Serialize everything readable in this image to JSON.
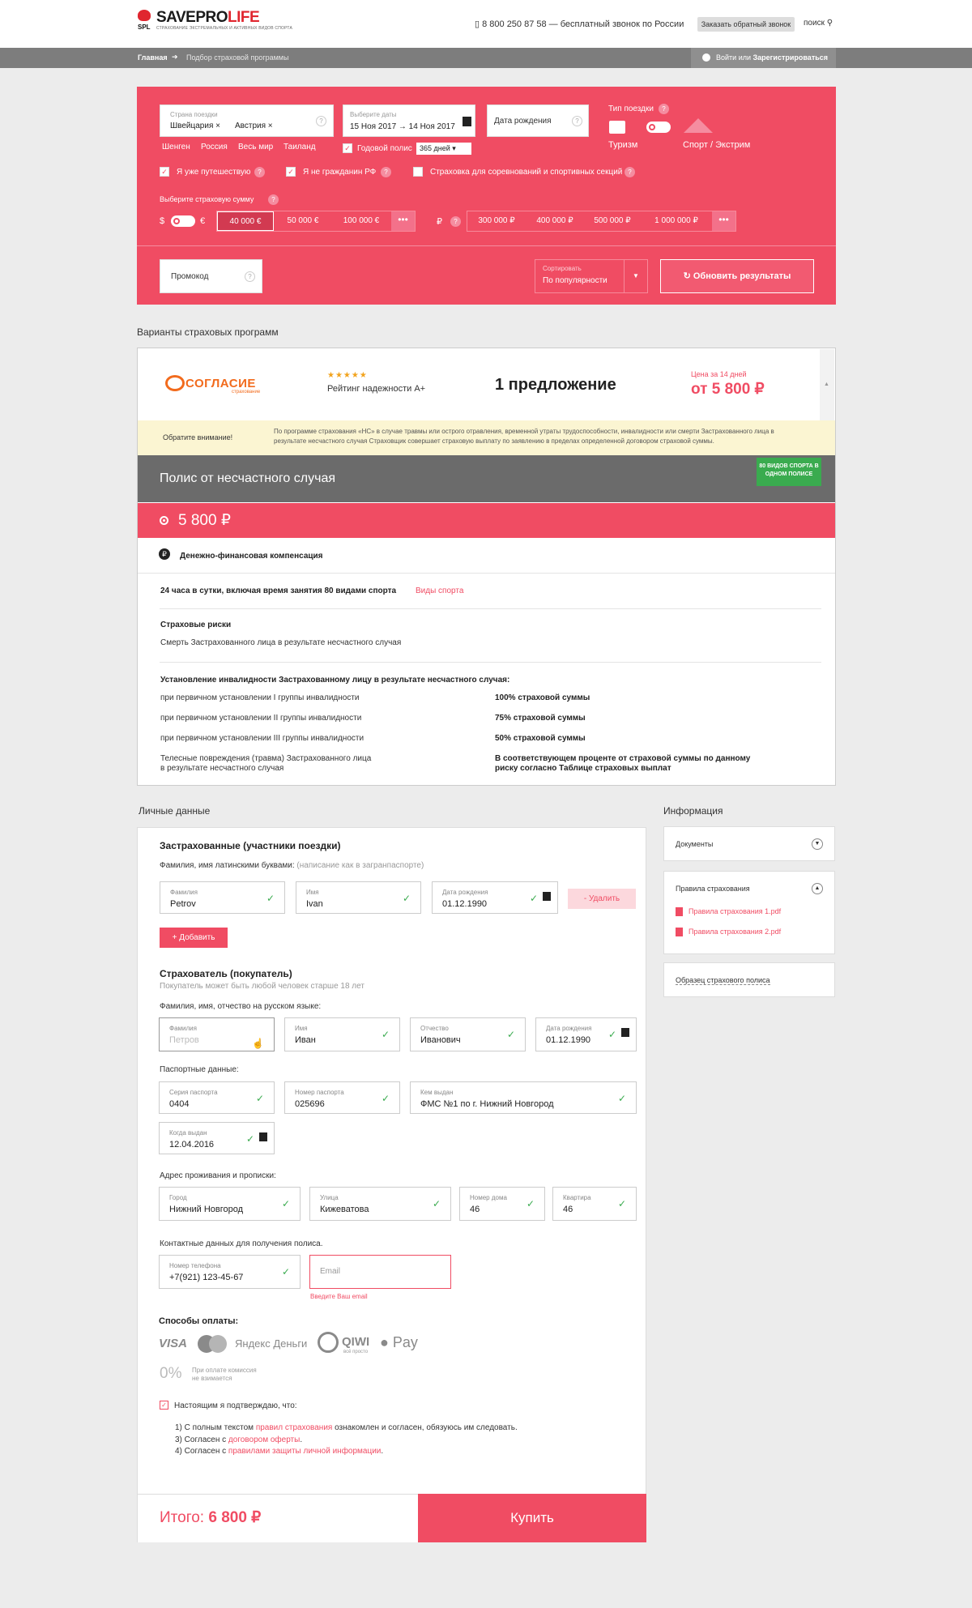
{
  "header": {
    "brand_a": "SAVEPRO",
    "brand_b": "LIFE",
    "brand_short": "SPL",
    "tagline": "СТРАХОВАНИЕ ЭКСТРЕМАЛЬНЫХ И АКТИВНЫХ ВИДОВ СПОРТА",
    "phone": "8 800 250 87 58 — бесплатный звонок по России",
    "callback": "Заказать обратный звонок",
    "search": "поиск"
  },
  "breadcrumb": {
    "home": "Главная",
    "current": "Подбор страховой программы",
    "login": "Войти",
    "or": "или",
    "register": "Зарегистрироваться"
  },
  "search_form": {
    "country_label": "Страна поездки",
    "country_tags": [
      "Швейцария ×",
      "Австрия ×"
    ],
    "quick_links": [
      "Шенген",
      "Россия",
      "Весь мир",
      "Таиланд"
    ],
    "dates_label": "Выберите даты",
    "dates_value": "15 Ноя 2017 → 14 Ноя 2017",
    "birth_placeholder": "Дата рождения",
    "annual_label": "Годовой полис",
    "annual_value": "365 дней",
    "trip_type_label": "Тип поездки",
    "trip_tourism": "Туризм",
    "trip_sport": "Спорт / Экстрим",
    "checks": [
      "Я уже путешествую",
      "Я не гражданин РФ",
      "Страховка для соревнований и спортивных секций"
    ],
    "sum_label": "Выберите страховую сумму",
    "cur_dollar": "$",
    "cur_euro": "€",
    "cur_rub": "₽",
    "sums_eur": [
      "40 000 €",
      "50 000 €",
      "100 000 €"
    ],
    "sums_rub": [
      "300 000 ₽",
      "400 000 ₽",
      "500 000 ₽",
      "1 000 000 ₽"
    ],
    "more": "•••",
    "promo": "Промокод",
    "sort_label": "Сортировать",
    "sort_value": "По популярности",
    "update": "Обновить результаты"
  },
  "results": {
    "title": "Варианты страховых программ",
    "insurer": "СОГЛАСИЕ",
    "insurer_sub": "страхование",
    "stars": "★★★★★",
    "rating": "Рейтинг надежности А+",
    "offers": "1 предложение",
    "price_label": "Цена за 14 дней",
    "price": "от 5 800 ₽",
    "notice_label": "Обратите внимание!",
    "notice_text": "По программе страхования «НС» в случае травмы или острого отравления, временной утраты трудоспособности, инвалидности или смерти Застрахованного лица в результате несчастного случая Страховщик совершает страховую выплату по заявлению в пределах определенной договором страховой суммы.",
    "policy_title": "Полис от несчастного случая",
    "badge": "80 ВИДОВ СПОРТА В ОДНОМ ПОЛИСЕ",
    "policy_price": "5 800 ₽",
    "compensation": "Денежно-финансовая компенсация",
    "coverage": "24 часа в сутки, включая время занятия 80 видами спорта",
    "sports_link": "Виды спорта",
    "risks_title": "Страховые риски",
    "risk1": "Смерть Застрахованного лица в результате несчастного случая",
    "disability_title": "Установление инвалидности Застрахованному лицу в результате несчастного случая:",
    "rows": [
      {
        "l": "при первичном установлении I группы инвалидности",
        "r": "100% страховой суммы"
      },
      {
        "l": "при первичном установлении II группы инвалидности",
        "r": "75% страховой суммы"
      },
      {
        "l": "при первичном установлении III группы инвалидности",
        "r": "50% страховой суммы"
      }
    ],
    "injury_l1": "Телесные повреждения (травма) Застрахованного лица",
    "injury_l2": "в результате несчастного случая",
    "injury_r1": "В соответствующем проценте от страховой суммы по данному",
    "injury_r2": "риску согласно Таблице страховых выплат"
  },
  "personal": {
    "title": "Личные данные",
    "insured_title": "Застрахованные (участники поездки)",
    "insured_hint": "Фамилия, имя латинскими буквами:",
    "insured_hint2": "(написание как в загранпаспорте)",
    "surname_l": "Фамилия",
    "surname_v": "Petrov",
    "name_l": "Имя",
    "name_v": "Ivan",
    "birth_l": "Дата рождения",
    "birth_v": "01.12.1990",
    "delete": "- Удалить",
    "add": "+ Добавить",
    "buyer_title": "Страхователь (покупатель)",
    "buyer_hint": "Покупатель может быть любой человек старше 18 лет",
    "fio_hint": "Фамилия, имя, отчество на русском языке:",
    "b_surname_l": "Фамилия",
    "b_surname_ph": "Петров",
    "b_name_l": "Имя",
    "b_name_v": "Иван",
    "b_patr_l": "Отчество",
    "b_patr_v": "Иванович",
    "b_birth_l": "Дата рождения",
    "b_birth_v": "01.12.1990",
    "passport_hint": "Паспортные данные:",
    "series_l": "Серия паспорта",
    "series_v": "0404",
    "number_l": "Номер паспорта",
    "number_v": "025696",
    "issued_l": "Кем выдан",
    "issued_v": "ФМС №1 по г. Нижний Новгород",
    "when_l": "Когда выдан",
    "when_v": "12.04.2016",
    "address_hint": "Адрес проживания и прописки:",
    "city_l": "Город",
    "city_v": "Нижний Новгород",
    "street_l": "Улица",
    "street_v": "Кижеватова",
    "house_l": "Номер дома",
    "house_v": "46",
    "flat_l": "Квартира",
    "flat_v": "46",
    "contact_hint": "Контактные данных для получения полиса.",
    "phone_l": "Номер телефона",
    "phone_v": "+7(921) 123-45-67",
    "email_ph": "Email",
    "email_err": "Введите Ваш email",
    "pay_title": "Способы оплаты:",
    "pay": [
      "VISA",
      "Яндекс Деньги",
      "QIWI",
      "Pay"
    ],
    "qiwi_sub": "всё просто",
    "commission": "0%",
    "commission_text": "При оплате комиссия не взимается",
    "confirm": "Настоящим я подтверждаю, что:",
    "c1_a": "1) С полным текстом ",
    "c1_link": "правил страхования",
    "c1_b": " ознакомлен и согласен, обязуюсь им следовать.",
    "c3_a": "3) Согласен с ",
    "c3_link": "договором оферты",
    "c4_a": "4) Согласен с ",
    "c4_link": "правилами защиты личной информации",
    "dot": ".",
    "total_label": "Итого:",
    "total": "6 800 ₽",
    "buy": "Купить"
  },
  "info": {
    "title": "Информация",
    "docs": "Документы",
    "rules": "Правила страхования",
    "pdf1": "Правила страхования 1.pdf",
    "pdf2": "Правила страхования 2.pdf",
    "sample": "Образец страхового полиса"
  }
}
